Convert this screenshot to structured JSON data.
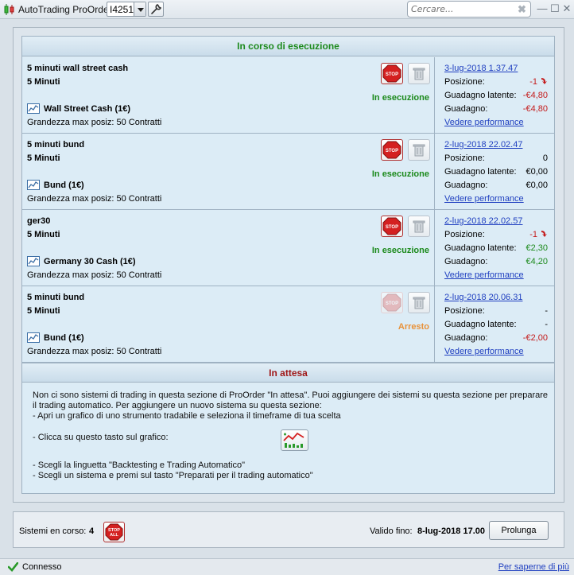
{
  "window": {
    "title": "AutoTrading ProOrder",
    "account": "I4251",
    "search_placeholder": "Cercare..."
  },
  "sections": {
    "running_title": "In corso di esecuzione",
    "waiting_title": "In attesa"
  },
  "labels": {
    "position": "Posizione:",
    "latent_gain": "Guadagno latente:",
    "gain": "Guadagno:",
    "performance_link": "Vedere performance"
  },
  "systems": [
    {
      "name": "5 minuti wall street cash",
      "timeframe": "5 Minuti",
      "instrument": "Wall Street Cash (1€)",
      "max_position": "Grandezza max posiz: 50 Contratti",
      "status": "In esecuzione",
      "date": "3-lug-2018 1.37.47",
      "position": "-1",
      "position_arrow": true,
      "latent_gain": "-€4,80",
      "gain": "-€4,80"
    },
    {
      "name": "5 minuti bund",
      "timeframe": "5 Minuti",
      "instrument": "Bund (1€)",
      "max_position": "Grandezza max posiz: 50 Contratti",
      "status": "In esecuzione",
      "date": "2-lug-2018 22.02.47",
      "position": "0",
      "position_arrow": false,
      "latent_gain": "€0,00",
      "gain": "€0,00"
    },
    {
      "name": "ger30",
      "timeframe": "5 Minuti",
      "instrument": "Germany 30 Cash (1€)",
      "max_position": "Grandezza max posiz: 50 Contratti",
      "status": "In esecuzione",
      "date": "2-lug-2018 22.02.57",
      "position": "-1",
      "position_arrow": true,
      "latent_gain": "€2,30",
      "gain": "€4,20"
    },
    {
      "name": "5 minuti bund",
      "timeframe": "5 Minuti",
      "instrument": "Bund (1€)",
      "max_position": "Grandezza max posiz: 50 Contratti",
      "status": "Arresto",
      "date": "2-lug-2018 20.06.31",
      "position": "-",
      "position_arrow": false,
      "latent_gain": "-",
      "gain": "-€2,00"
    }
  ],
  "waiting": {
    "line1": "Non ci sono sistemi di trading in questa sezione di ProOrder \"In attesa\". Puoi aggiungere dei sistemi su questa sezione per preparare",
    "line2": "il trading automatico. Per aggiungere un nuovo sistema su questa sezione:",
    "line3": "- Apri un grafico di uno strumento tradabile e seleziona il timeframe di tua scelta",
    "line4": "- Clicca su questo tasto sul grafico:",
    "line5": "- Scegli la linguetta \"Backtesting e Trading Automatico\"",
    "line6": "- Scegli un sistema e premi sul tasto \"Preparati per il trading automatico\""
  },
  "footer": {
    "running_label": "Sistemi en corso:",
    "running_count": "4",
    "valid_label": "Valido fino:",
    "valid_date": "8-lug-2018 17.00",
    "prolong_label": "Prolunga"
  },
  "statusbar": {
    "connection": "Connesso",
    "more_link": "Per saperne di più"
  },
  "colors": {
    "running": "#1c8a1c",
    "stopped": "#e8923a",
    "negative": "#c41a1a",
    "positive": "#1c8a1c",
    "link": "#1f3fc0"
  }
}
